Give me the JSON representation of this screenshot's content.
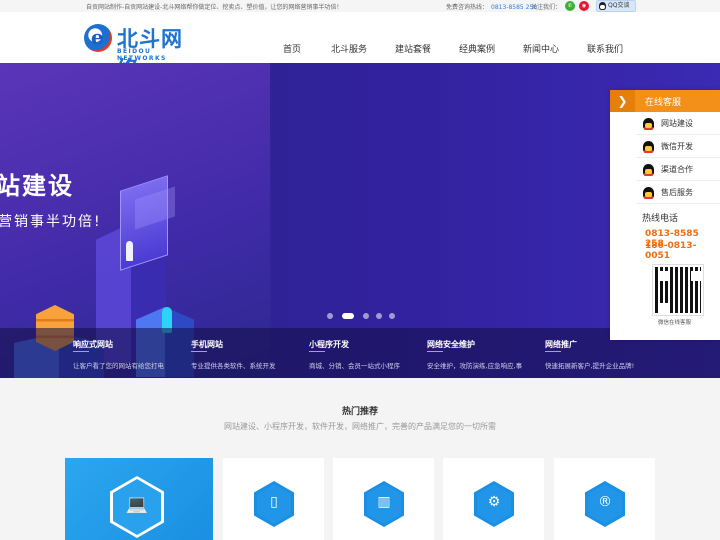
{
  "topbar": {
    "intro": "自贡网站制作-自贡网站建设-北斗网络帮你做定位、挖卖点、塑价值，让您的网络营销事半功倍！",
    "hotline_label": "免费咨询热线：",
    "hotline_number": "0813-8585 258",
    "follow_label": "关注我们：",
    "wechat_icon": "wechat-icon",
    "weibo_icon": "weibo-icon",
    "qq_label": "QQ交谈"
  },
  "logo": {
    "cn": "北斗网络",
    "en": "BEIDOU NETWORKS"
  },
  "nav": {
    "items": [
      "首页",
      "北斗服务",
      "建站套餐",
      "经典案例",
      "新闻中心",
      "联系我们"
    ]
  },
  "banner": {
    "headline": "站建设",
    "subline": "营销事半功倍!",
    "slide_count": 5,
    "active_slide": 2,
    "features": [
      {
        "title": "响应式网站",
        "desc": "让客户看了您的网站有给您打电"
      },
      {
        "title": "手机网站",
        "desc": "专业提供各类软件、系统开发"
      },
      {
        "title": "小程序开发",
        "desc": "商城、分销、会员一站式小程序"
      },
      {
        "title": "网络安全维护",
        "desc": "安全维护，攻防演练,应急响应,事"
      },
      {
        "title": "网络推广",
        "desc": "快速拓展新客户,提升企业品牌!"
      }
    ]
  },
  "service": {
    "title": "在线客服",
    "items": [
      "网站建设",
      "微信开发",
      "渠道合作",
      "售后服务"
    ],
    "hotline_title": "热线电话",
    "phones": [
      "0813-8585 258",
      "186-0813-0051"
    ],
    "qr_caption": "微信在线客服"
  },
  "hot": {
    "title": "热门推荐",
    "subtitle": "网站建设、小程序开发，软件开发，网络推广，完善的产品满足您的一切所需",
    "cards": [
      {
        "icon": "laptop-icon",
        "glyph": "💻"
      },
      {
        "icon": "mobile-icon",
        "glyph": "▯"
      },
      {
        "icon": "chart-icon",
        "glyph": "▥"
      },
      {
        "icon": "gear-icon",
        "glyph": "⚙"
      },
      {
        "icon": "registered-icon",
        "glyph": "®"
      }
    ]
  },
  "colors": {
    "brand_blue": "#1d72d2",
    "accent_orange": "#f39019",
    "banner_purple": "#3322a0"
  }
}
